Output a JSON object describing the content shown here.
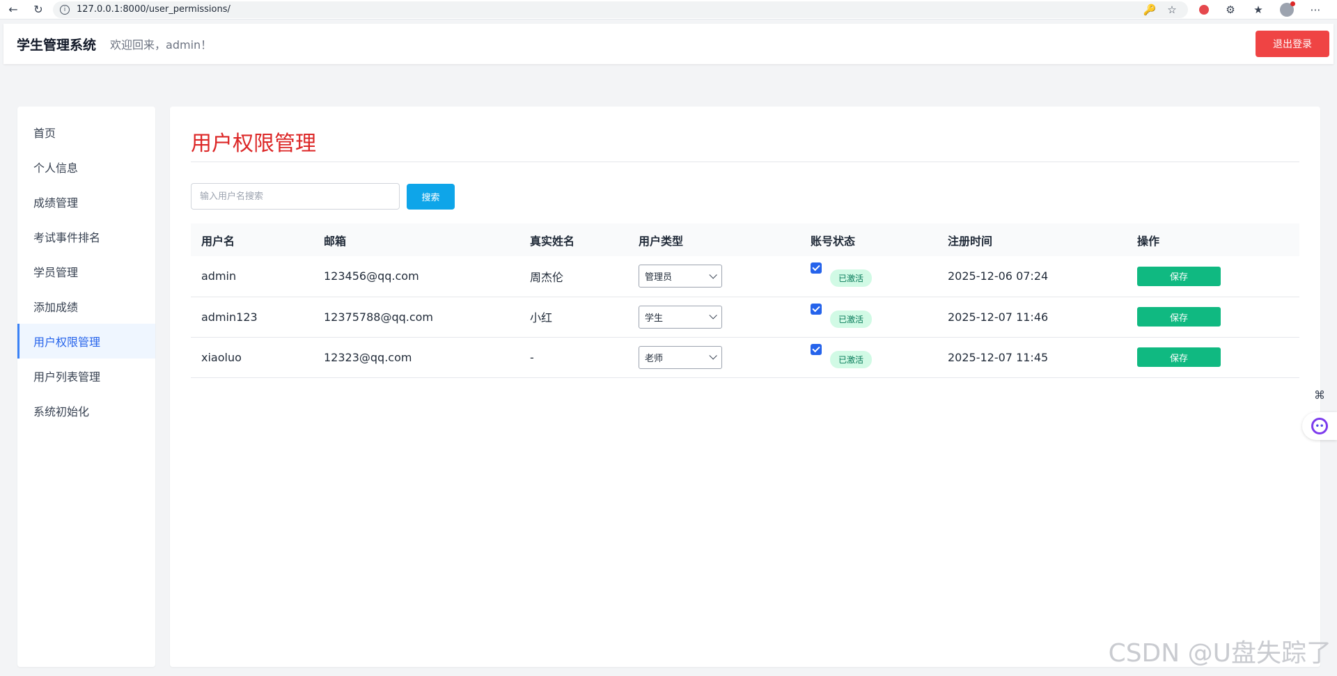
{
  "browser": {
    "url": "127.0.0.1:8000/user_permissions/"
  },
  "header": {
    "brand": "学生管理系统",
    "welcome": "欢迎回来，admin！",
    "logout_label": "退出登录"
  },
  "sidebar": {
    "items": [
      {
        "label": "首页"
      },
      {
        "label": "个人信息"
      },
      {
        "label": "成绩管理"
      },
      {
        "label": "考试事件排名"
      },
      {
        "label": "学员管理"
      },
      {
        "label": "添加成绩"
      },
      {
        "label": "用户权限管理",
        "active": true
      },
      {
        "label": "用户列表管理"
      },
      {
        "label": "系统初始化"
      }
    ]
  },
  "main": {
    "title": "用户权限管理",
    "search": {
      "placeholder": "输入用户名搜索",
      "button_label": "搜索"
    },
    "table": {
      "columns": [
        "用户名",
        "邮箱",
        "真实姓名",
        "用户类型",
        "账号状态",
        "注册时间",
        "操作"
      ],
      "rows": [
        {
          "username": "admin",
          "email": "123456@qq.com",
          "real_name": "周杰伦",
          "user_type": "管理员",
          "active": true,
          "status": "已激活",
          "registered": "2025-12-06 07:24",
          "action": "保存"
        },
        {
          "username": "admin123",
          "email": "12375788@qq.com",
          "real_name": "小红",
          "user_type": "学生",
          "active": true,
          "status": "已激活",
          "registered": "2025-12-07 11:46",
          "action": "保存"
        },
        {
          "username": "xiaoluo",
          "email": "12323@qq.com",
          "real_name": "-",
          "user_type": "老师",
          "active": true,
          "status": "已激活",
          "registered": "2025-12-07 11:45",
          "action": "保存"
        }
      ]
    }
  },
  "watermark": "CSDN @U盘失踪了",
  "colors": {
    "danger": "#ef4444",
    "title": "#dc2626",
    "primary": "#0ea5e9",
    "success": "#10b981",
    "active_nav": "#2563eb"
  }
}
